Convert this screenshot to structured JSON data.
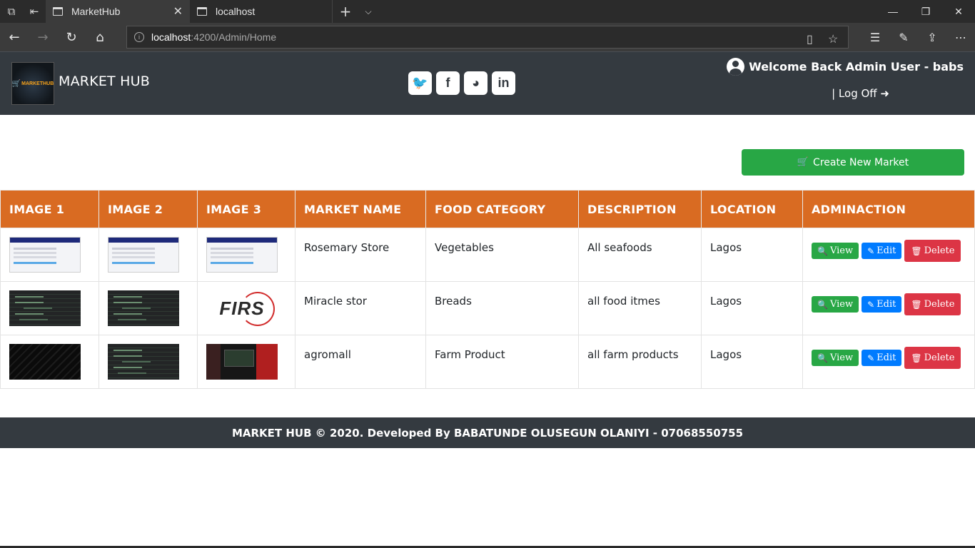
{
  "browser": {
    "tabs": [
      {
        "title": "MarketHub",
        "active": true
      },
      {
        "title": "localhost",
        "active": false
      }
    ],
    "url_host": "localhost",
    "url_path": ":4200/Admin/Home",
    "window_controls": [
      "minimize",
      "restore",
      "close"
    ],
    "icons": [
      "tab-list-icon",
      "set-aside-icon",
      "back-icon",
      "forward-icon",
      "refresh-icon",
      "home-icon",
      "reading-view-icon",
      "favorite-star-icon",
      "favorites-icon",
      "notes-icon",
      "share-icon",
      "more-icon"
    ]
  },
  "header": {
    "logo_text": "MARKETHUB",
    "brand": "MARKET HUB",
    "socials": [
      "twitter",
      "facebook",
      "github",
      "linkedin"
    ],
    "welcome": "Welcome Back Admin User - babs",
    "logoff": "| Log Off"
  },
  "main": {
    "create_button": "Create New Market",
    "columns": [
      "IMAGE 1",
      "IMAGE 2",
      "IMAGE 3",
      "MARKET NAME",
      "FOOD CATEGORY",
      "DESCRIPTION",
      "LOCATION",
      "ADMINACTION"
    ],
    "actions": {
      "view": "View",
      "edit": "Edit",
      "delete": "Delete"
    },
    "rows": [
      {
        "market_name": "Rosemary Store",
        "food_category": "Vegetables",
        "description": "All seafoods",
        "location": "Lagos"
      },
      {
        "market_name": "Miracle stor",
        "food_category": "Breads",
        "description": "all food itmes",
        "location": "Lagos"
      },
      {
        "market_name": "agromall",
        "food_category": "Farm Product",
        "description": "all farm products",
        "location": "Lagos"
      }
    ],
    "firs_logo_text": "FIRS"
  },
  "footer": {
    "text": "MARKET HUB © 2020. Developed By BABATUNDE OLUSEGUN OLANIYI - 07068550755"
  },
  "colors": {
    "header_bg": "#343a40",
    "table_header": "#d96b22",
    "success": "#28a745",
    "primary": "#007bff",
    "danger": "#dc3545"
  }
}
